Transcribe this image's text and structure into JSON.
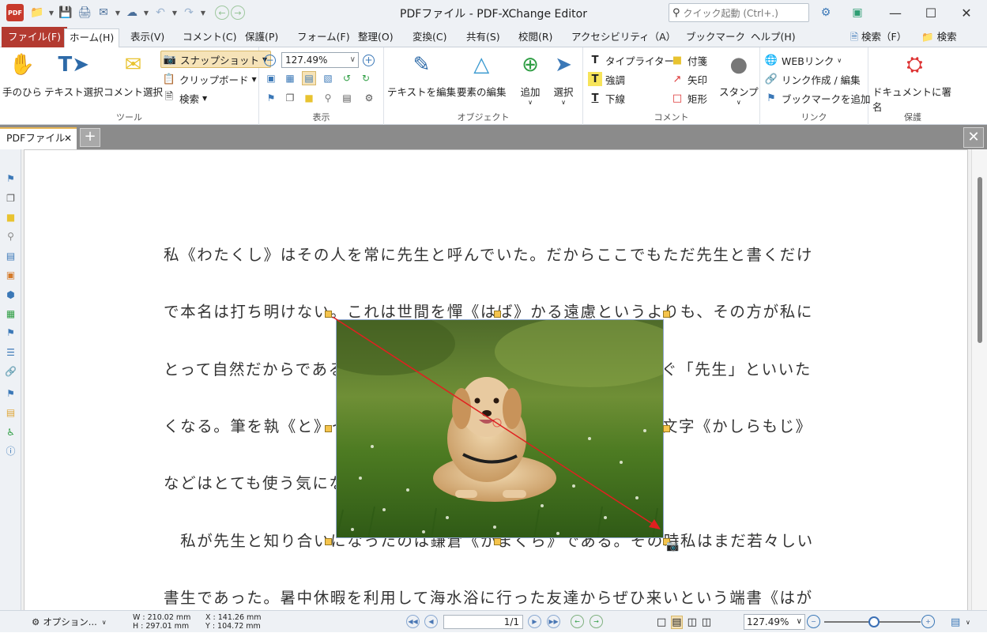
{
  "window": {
    "title": "PDFファイル - PDF-XChange Editor",
    "app_icon_text": "PDF",
    "search_placeholder": "クイック起動 (Ctrl+.)"
  },
  "menu": [
    {
      "label": "ファイル(F)",
      "x": 0
    },
    {
      "label": "ホーム(H)"
    },
    {
      "label": "表示(V)"
    },
    {
      "label": "コメント(C)"
    },
    {
      "label": "保護(P)"
    },
    {
      "label": "フォーム(F)"
    },
    {
      "label": "整理(O)"
    },
    {
      "label": "変換(C)"
    },
    {
      "label": "共有(S)"
    },
    {
      "label": "校閲(R)"
    },
    {
      "label": "アクセシビリティ（A）"
    },
    {
      "label": "ブックマーク"
    },
    {
      "label": "ヘルプ(H)"
    }
  ],
  "menu_right": {
    "search_f": "検索（F）",
    "search": "検索"
  },
  "ribbon": {
    "tools": {
      "label": "ツール",
      "hand": "手のひら",
      "text_select": "テキスト選択",
      "comment_select": "コメント選択",
      "snapshot": "スナップショット",
      "clipboard": "クリップボード",
      "search": "検索"
    },
    "view": {
      "label": "表示",
      "zoom": "127.49%"
    },
    "objects": {
      "label": "オブジェクト",
      "edit_text": "テキストを編集",
      "edit_elements": "要素の編集",
      "add": "追加",
      "select": "選択"
    },
    "comments": {
      "label": "コメント",
      "typewriter": "タイプライター",
      "highlight": "強調",
      "underline": "下線",
      "note": "付箋",
      "arrow": "矢印",
      "rectangle": "矩形",
      "stamp": "スタンプ"
    },
    "links": {
      "label": "リンク",
      "web_link": "WEBリンク",
      "create_link": "リンク作成 / 編集",
      "add_bookmark": "ブックマークを追加"
    },
    "protect": {
      "label": "保護",
      "sign": "ドキュメントに署名"
    }
  },
  "tabs": {
    "doc_tab": "PDFファイル",
    "new_tab": "+"
  },
  "document": {
    "lines": [
      "私《わたくし》はその人を常に先生と呼んでいた。だからここでもただ先生と書くだけ",
      "で本名は打ち明けない。これは世間を憚《はば》かる遠慮というよりも、その方が私に",
      "とって自然だからである。私はその人の記憶を呼び起すごとに、すぐ「先生」といいた",
      "くなる。筆を執《と》っても心持は同じ事である。よそよそしい頭文字《かしらもじ》",
      "などはとても使う気にならない。",
      "　私が先生と知り合いになったのは鎌倉《かまくら》である。その時私はまだ若々しい",
      "書生であった。暑中休暇を利用して海水浴に行った友達からぜひ来いという端書《はが"
    ]
  },
  "status": {
    "options": "オプション...",
    "width": "W : 210.02 mm",
    "height": "H : 297.01 mm",
    "x": "X : 141.26 mm",
    "y": "Y : 104.72 mm",
    "page": "1/1",
    "zoom": "127.49%"
  }
}
